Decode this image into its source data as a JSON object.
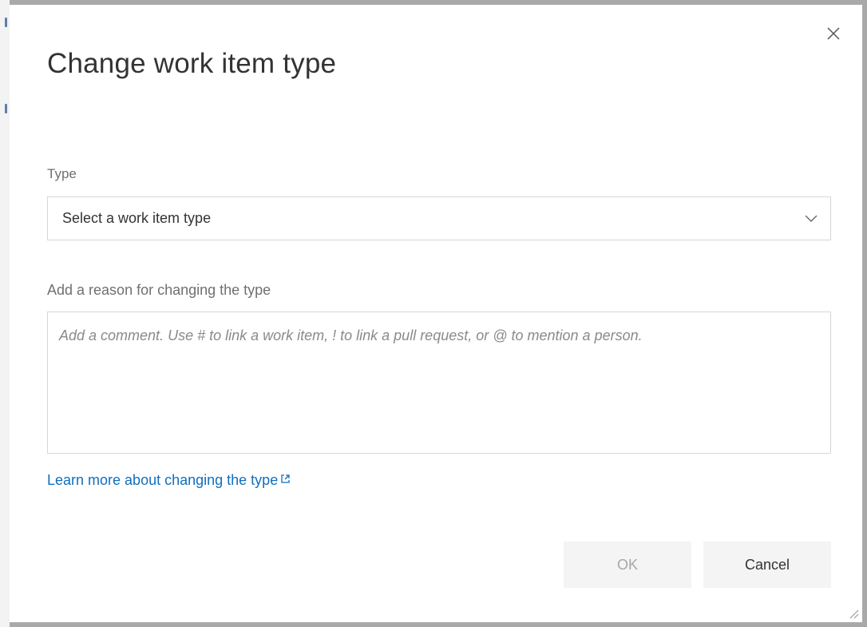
{
  "dialog": {
    "title": "Change work item type",
    "close_icon": "close-icon"
  },
  "type_field": {
    "label": "Type",
    "placeholder": "Select a work item type",
    "dropdown_icon": "chevron-down-icon"
  },
  "reason_field": {
    "label": "Add a reason for changing the type",
    "placeholder": "Add a comment. Use # to link a work item, ! to link a pull request, or @ to mention a person.",
    "value": ""
  },
  "learn_more": {
    "label": "Learn more about changing the type",
    "icon": "external-link-icon"
  },
  "buttons": {
    "ok_label": "OK",
    "ok_enabled": false,
    "cancel_label": "Cancel"
  },
  "colors": {
    "link": "#106ebe",
    "disabled_text": "#a6a6a6",
    "button_bg": "#f4f4f4"
  }
}
